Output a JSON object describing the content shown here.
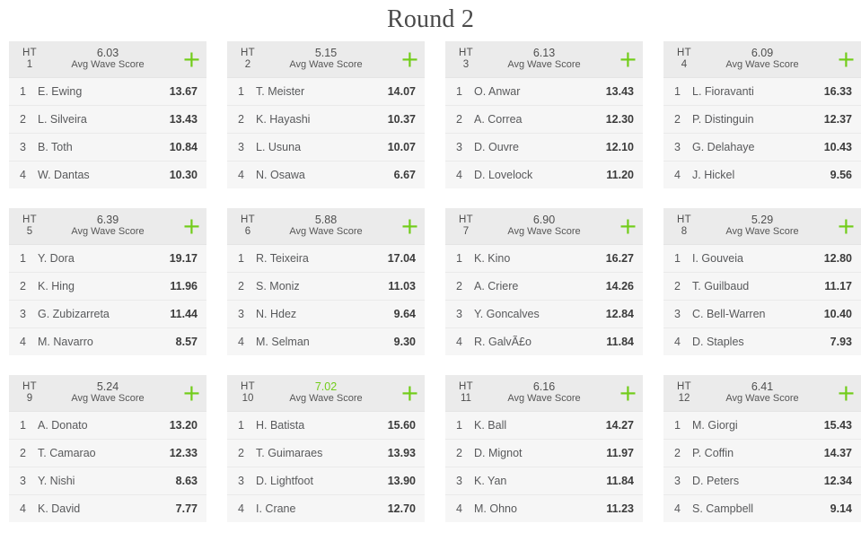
{
  "page": {
    "title": "Round 2",
    "accent_green": "#72cc1a",
    "card_bg": "#f6f6f6",
    "header_bg": "#ebebeb",
    "text_color": "#58595b"
  },
  "card_common": {
    "heat_word": "HT",
    "avg_caption": "Avg Wave Score",
    "add_icon": "plus-icon"
  },
  "heats": [
    {
      "number": "1",
      "avg": "6.03",
      "avg_highlight": false,
      "athletes": [
        {
          "seed": "1",
          "name": "E. Ewing",
          "score": "13.67"
        },
        {
          "seed": "2",
          "name": "L. Silveira",
          "score": "13.43"
        },
        {
          "seed": "3",
          "name": "B. Toth",
          "score": "10.84"
        },
        {
          "seed": "4",
          "name": "W. Dantas",
          "score": "10.30"
        }
      ]
    },
    {
      "number": "2",
      "avg": "5.15",
      "avg_highlight": false,
      "athletes": [
        {
          "seed": "1",
          "name": "T. Meister",
          "score": "14.07"
        },
        {
          "seed": "2",
          "name": "K. Hayashi",
          "score": "10.37"
        },
        {
          "seed": "3",
          "name": "L. Usuna",
          "score": "10.07"
        },
        {
          "seed": "4",
          "name": "N. Osawa",
          "score": "6.67"
        }
      ]
    },
    {
      "number": "3",
      "avg": "6.13",
      "avg_highlight": false,
      "athletes": [
        {
          "seed": "1",
          "name": "O. Anwar",
          "score": "13.43"
        },
        {
          "seed": "2",
          "name": "A. Correa",
          "score": "12.30"
        },
        {
          "seed": "3",
          "name": "D. Ouvre",
          "score": "12.10"
        },
        {
          "seed": "4",
          "name": "D. Lovelock",
          "score": "11.20"
        }
      ]
    },
    {
      "number": "4",
      "avg": "6.09",
      "avg_highlight": false,
      "athletes": [
        {
          "seed": "1",
          "name": "L. Fioravanti",
          "score": "16.33"
        },
        {
          "seed": "2",
          "name": "P. Distinguin",
          "score": "12.37"
        },
        {
          "seed": "3",
          "name": "G. Delahaye",
          "score": "10.43"
        },
        {
          "seed": "4",
          "name": "J. Hickel",
          "score": "9.56"
        }
      ]
    },
    {
      "number": "5",
      "avg": "6.39",
      "avg_highlight": false,
      "athletes": [
        {
          "seed": "1",
          "name": "Y. Dora",
          "score": "19.17"
        },
        {
          "seed": "2",
          "name": "K. Hing",
          "score": "11.96"
        },
        {
          "seed": "3",
          "name": "G. Zubizarreta",
          "score": "11.44"
        },
        {
          "seed": "4",
          "name": "M. Navarro",
          "score": "8.57"
        }
      ]
    },
    {
      "number": "6",
      "avg": "5.88",
      "avg_highlight": false,
      "athletes": [
        {
          "seed": "1",
          "name": "R. Teixeira",
          "score": "17.04"
        },
        {
          "seed": "2",
          "name": "S. Moniz",
          "score": "11.03"
        },
        {
          "seed": "3",
          "name": "N. Hdez",
          "score": "9.64"
        },
        {
          "seed": "4",
          "name": "M. Selman",
          "score": "9.30"
        }
      ]
    },
    {
      "number": "7",
      "avg": "6.90",
      "avg_highlight": false,
      "athletes": [
        {
          "seed": "1",
          "name": "K. Kino",
          "score": "16.27"
        },
        {
          "seed": "2",
          "name": "A. Criere",
          "score": "14.26"
        },
        {
          "seed": "3",
          "name": "Y. Goncalves",
          "score": "12.84"
        },
        {
          "seed": "4",
          "name": "R. GalvÃ£o",
          "score": "11.84"
        }
      ]
    },
    {
      "number": "8",
      "avg": "5.29",
      "avg_highlight": false,
      "athletes": [
        {
          "seed": "1",
          "name": "I. Gouveia",
          "score": "12.80"
        },
        {
          "seed": "2",
          "name": "T. Guilbaud",
          "score": "11.17"
        },
        {
          "seed": "3",
          "name": "C. Bell-Warren",
          "score": "10.40"
        },
        {
          "seed": "4",
          "name": "D. Staples",
          "score": "7.93"
        }
      ]
    },
    {
      "number": "9",
      "avg": "5.24",
      "avg_highlight": false,
      "athletes": [
        {
          "seed": "1",
          "name": "A. Donato",
          "score": "13.20"
        },
        {
          "seed": "2",
          "name": "T. Camarao",
          "score": "12.33"
        },
        {
          "seed": "3",
          "name": "Y. Nishi",
          "score": "8.63"
        },
        {
          "seed": "4",
          "name": "K. David",
          "score": "7.77"
        }
      ]
    },
    {
      "number": "10",
      "avg": "7.02",
      "avg_highlight": true,
      "athletes": [
        {
          "seed": "1",
          "name": "H. Batista",
          "score": "15.60"
        },
        {
          "seed": "2",
          "name": "T. Guimaraes",
          "score": "13.93"
        },
        {
          "seed": "3",
          "name": "D. Lightfoot",
          "score": "13.90"
        },
        {
          "seed": "4",
          "name": "I. Crane",
          "score": "12.70"
        }
      ]
    },
    {
      "number": "11",
      "avg": "6.16",
      "avg_highlight": false,
      "athletes": [
        {
          "seed": "1",
          "name": "K. Ball",
          "score": "14.27"
        },
        {
          "seed": "2",
          "name": "D. Mignot",
          "score": "11.97"
        },
        {
          "seed": "3",
          "name": "K. Yan",
          "score": "11.84"
        },
        {
          "seed": "4",
          "name": "M. Ohno",
          "score": "11.23"
        }
      ]
    },
    {
      "number": "12",
      "avg": "6.41",
      "avg_highlight": false,
      "athletes": [
        {
          "seed": "1",
          "name": "M. Giorgi",
          "score": "15.43"
        },
        {
          "seed": "2",
          "name": "P. Coffin",
          "score": "14.37"
        },
        {
          "seed": "3",
          "name": "D. Peters",
          "score": "12.34"
        },
        {
          "seed": "4",
          "name": "S. Campbell",
          "score": "9.14"
        }
      ]
    }
  ]
}
